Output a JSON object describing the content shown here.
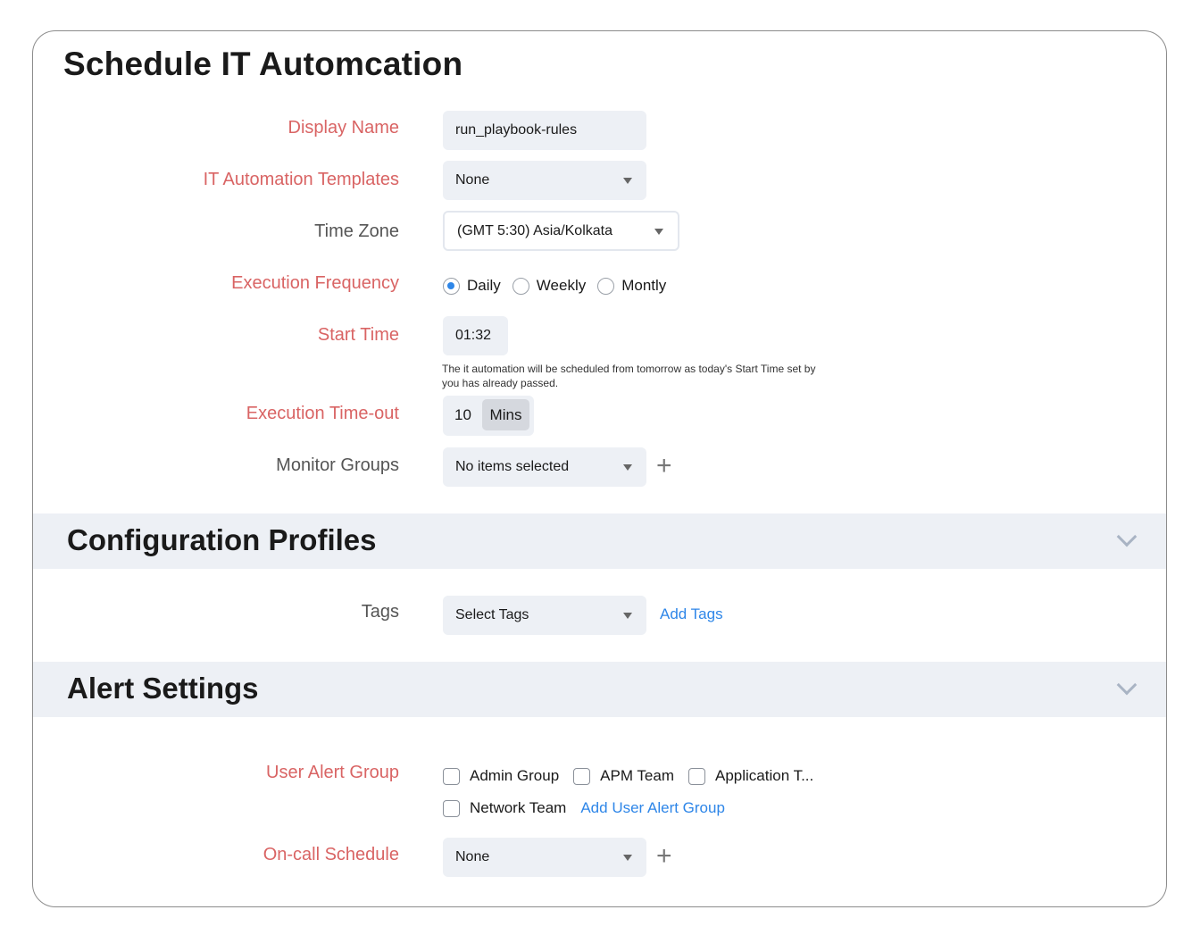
{
  "page": {
    "title": "Schedule IT Automcation"
  },
  "form": {
    "display_name": {
      "label": "Display Name",
      "value": "run_playbook-rules"
    },
    "templates": {
      "label": "IT Automation Templates",
      "value": "None"
    },
    "time_zone": {
      "label": "Time Zone",
      "value": "(GMT 5:30) Asia/Kolkata"
    },
    "frequency": {
      "label": "Execution Frequency",
      "options": [
        "Daily",
        "Weekly",
        "Montly"
      ],
      "selected": "Daily"
    },
    "start_time": {
      "label": "Start Time",
      "value": "01:32",
      "hint": "The it automation will be scheduled from tomorrow as today's Start Time set by you has already passed."
    },
    "timeout": {
      "label": "Execution Time-out",
      "value": "10",
      "unit": "Mins"
    },
    "monitor_groups": {
      "label": "Monitor Groups",
      "value": "No items selected"
    }
  },
  "config_profiles": {
    "title": "Configuration Profiles",
    "tags": {
      "label": "Tags",
      "value": "Select Tags",
      "add_link": "Add Tags"
    }
  },
  "alert_settings": {
    "title": "Alert Settings",
    "user_alert_group": {
      "label": "User Alert Group",
      "options": [
        "Admin Group",
        "APM Team",
        "Application T...",
        "Network Team"
      ],
      "add_link": "Add User Alert Group"
    },
    "on_call": {
      "label": "On-call Schedule",
      "value": "None"
    }
  },
  "colors": {
    "required_label": "#d96464",
    "link": "#2e86e8",
    "field_bg": "#edf0f5",
    "section_bg": "#edf0f5"
  },
  "icons": [
    "caret-down-icon",
    "plus-icon",
    "chevron-down-icon"
  ]
}
